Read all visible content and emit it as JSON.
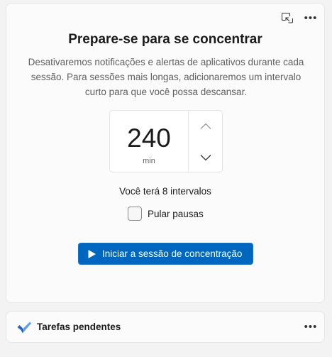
{
  "focus": {
    "title": "Prepare-se para se concentrar",
    "description": "Desativaremos notificações e alertas de aplicativos durante cada sessão. Para sessões mais longas, adicionaremos um intervalo curto para que você possa descansar.",
    "timer": {
      "value": "240",
      "unit": "min"
    },
    "intervals_text": "Você terá 8 intervalos",
    "skip_breaks": {
      "label": "Pular pausas",
      "checked": false
    },
    "start_button": {
      "label": "Iniciar a sessão de concentração"
    }
  },
  "tasks": {
    "title": "Tarefas pendentes"
  },
  "icons": {
    "detach": "detach-window-icon",
    "more": "more-options-icon",
    "up": "chevron-up-icon",
    "down": "chevron-down-icon",
    "play": "play-icon",
    "todo": "todo-check-icon"
  },
  "colors": {
    "accent": "#0067c0",
    "todo_blue": "#2564cf"
  }
}
